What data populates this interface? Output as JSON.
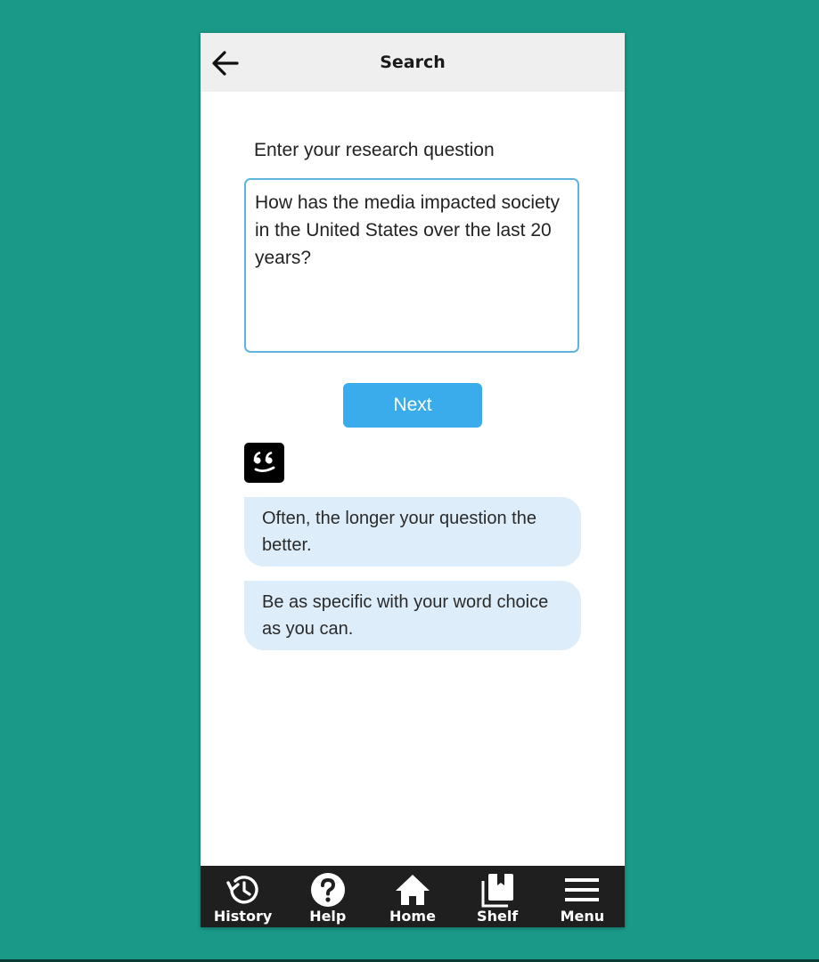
{
  "header": {
    "title": "Search",
    "back_icon": "arrow-left-icon"
  },
  "form": {
    "label": "Enter your research question",
    "question_value": "How has the media impacted society in the United States over the last 20 years?",
    "next_label": "Next"
  },
  "tips": {
    "avatar_icon": "quote-face-icon",
    "items": [
      "Often, the longer your question the better.",
      "Be as specific with your word choice as you can."
    ]
  },
  "nav": {
    "items": [
      {
        "label": "History",
        "icon": "history-icon"
      },
      {
        "label": "Help",
        "icon": "help-icon"
      },
      {
        "label": "Home",
        "icon": "home-icon"
      },
      {
        "label": "Shelf",
        "icon": "shelf-icon"
      },
      {
        "label": "Menu",
        "icon": "menu-icon"
      }
    ]
  },
  "colors": {
    "background": "#1b9988",
    "accent": "#3aacec",
    "input_border": "#5db5dd",
    "tip_bubble": "#ddeefa",
    "nav_bar": "#1f1f1f",
    "header_bar": "#efefef"
  }
}
